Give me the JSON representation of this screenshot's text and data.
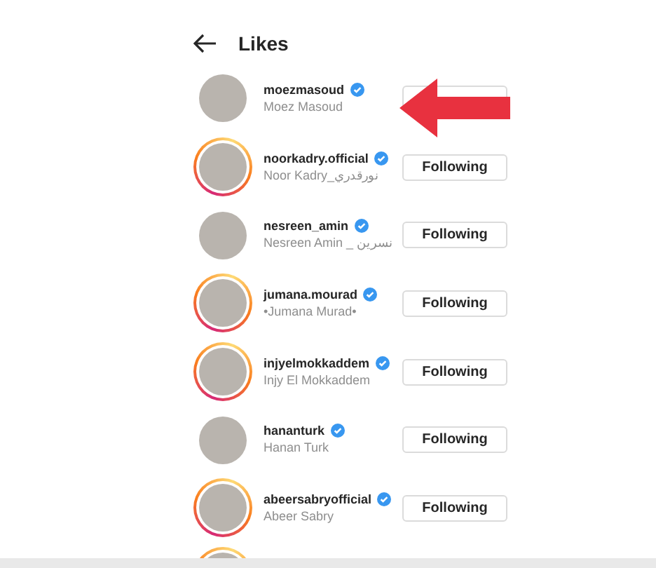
{
  "header": {
    "title": "Likes"
  },
  "users": [
    {
      "username": "moezmasoud",
      "full_name": "Moez Masoud",
      "verified": true,
      "story_ring": false
    },
    {
      "username": "noorkadry.official",
      "full_name": "Noor Kadry_نورقدري",
      "verified": true,
      "story_ring": true,
      "button": "Following"
    },
    {
      "username": "nesreen_amin",
      "full_name": "Nesreen Amin _ نسرين",
      "verified": true,
      "story_ring": false,
      "button": "Following"
    },
    {
      "username": "jumana.mourad",
      "full_name": "•Jumana Murad•",
      "verified": true,
      "story_ring": true,
      "button": "Following"
    },
    {
      "username": "injyelmokkaddem",
      "full_name": "Injy El Mokkaddem",
      "verified": true,
      "story_ring": true,
      "button": "Following"
    },
    {
      "username": "hananturk",
      "full_name": "Hanan Turk",
      "verified": true,
      "story_ring": false,
      "button": "Following"
    },
    {
      "username": "abeersabryofficial",
      "full_name": "Abeer Sabry",
      "verified": true,
      "story_ring": true,
      "button": "Following"
    },
    {
      "story_ring": true
    }
  ],
  "annotation": {
    "kind": "arrow"
  }
}
